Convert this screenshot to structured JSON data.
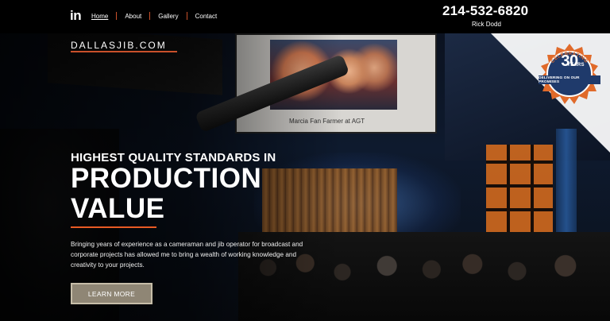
{
  "header": {
    "logo_glyph": "in",
    "nav": [
      {
        "label": "Home",
        "active": true
      },
      {
        "label": "About",
        "active": false
      },
      {
        "label": "Gallery",
        "active": false
      },
      {
        "label": "Contact",
        "active": false
      }
    ],
    "phone": "214-532-6820",
    "owner": "Rick Dodd"
  },
  "hero": {
    "site_logo": "DALLASJIB.COM",
    "screen_caption": "Marcia Fan Farmer at AGT",
    "tagline": "HIGHEST QUALITY STANDARDS IN",
    "headline_line1": "PRODUCTION",
    "headline_line2": "VALUE",
    "body": "Bringing years of experience as a cameraman and jib operator for broadcast and corporate projects has allowed me to bring a wealth of working knowledge and creativity to your projects.",
    "cta_label": "LEARN MORE"
  },
  "badge": {
    "arc_text": "CELEBRATING",
    "years": "30",
    "years_suffix": "YEARS",
    "ribbon": "DELIVERING ON OUR PROMISES"
  },
  "colors": {
    "accent_orange": "#e85a24",
    "badge_blue": "#1f3a6b",
    "badge_orange": "#e06a2a",
    "cta_bg": "#8f8675"
  },
  "icons": {
    "logo": "linkedin-logo-icon"
  }
}
